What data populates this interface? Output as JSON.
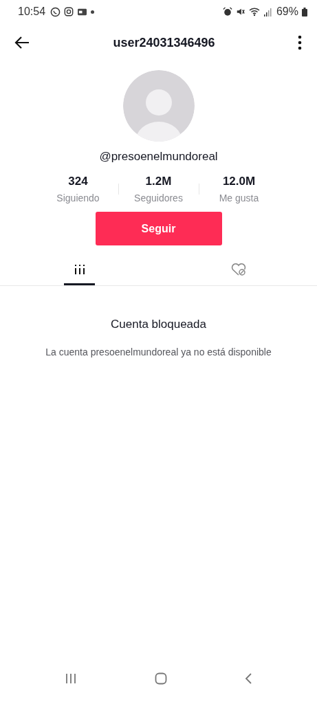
{
  "status_bar": {
    "time": "10:54",
    "battery": "69%"
  },
  "header": {
    "title": "user24031346496"
  },
  "profile": {
    "handle": "@presoenelmundoreal",
    "stats": [
      {
        "value": "324",
        "label": "Siguiendo"
      },
      {
        "value": "1.2M",
        "label": "Seguidores"
      },
      {
        "value": "12.0M",
        "label": "Me gusta"
      }
    ],
    "follow_button": "Seguir"
  },
  "tabs": [
    {
      "kind": "videos",
      "selected": true
    },
    {
      "kind": "liked",
      "selected": false
    }
  ],
  "notice": {
    "title": "Cuenta bloqueada",
    "message": "La cuenta presoenelmundoreal ya no está disponible"
  }
}
